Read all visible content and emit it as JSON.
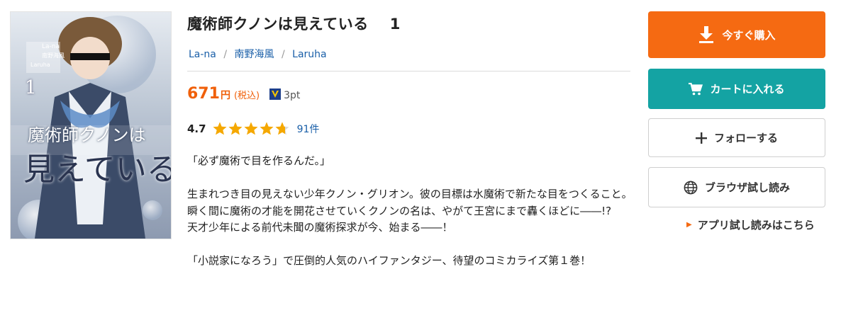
{
  "product": {
    "title": "魔術師クノンは見えている",
    "volume": "1",
    "authors": [
      "La-na",
      "南野海風",
      "Laruha"
    ],
    "author_separator": "/",
    "price": "671",
    "price_unit": "円",
    "tax_note": "(税込)",
    "points": "3pt",
    "rating_value": "4.7",
    "rating_stars": 4.7,
    "review_count": "91件",
    "accent_color": "#f56a12"
  },
  "cover": {
    "title_line1": "魔術師クノンは",
    "title_line2": "見えている",
    "volume_mark": "1",
    "credit_1": "La-na",
    "credit_2": "南野海風",
    "credit_3": "Laruha"
  },
  "description": {
    "paragraphs": [
      "「必ず魔術で目を作るんだ。」",
      "",
      "生まれつき目の見えない少年クノン・グリオン。彼の目標は水魔術で新たな目をつくること。",
      "瞬く間に魔術の才能を開花させていくクノンの名は、やがて王宮にまで轟くほどに――!?",
      "天才少年による前代未聞の魔術探求が今、始まる――！",
      "",
      "「小説家になろう」で圧倒的人気のハイファンタジー、待望のコミカライズ第１巻！"
    ]
  },
  "actions": {
    "buy_now": "今すぐ購入",
    "add_to_cart": "カートに入れる",
    "follow": "フォローする",
    "browser_trial": "ブラウザ試し読み",
    "app_trial": "アプリ試し読みはこちら",
    "buy_color": "#f56a12",
    "cart_color": "#14a3a3"
  },
  "icons": {
    "buy": "download-icon",
    "cart": "cart-icon",
    "follow": "plus-icon",
    "trial": "globe-icon",
    "points": "v-point-icon",
    "star": "star-icon"
  }
}
